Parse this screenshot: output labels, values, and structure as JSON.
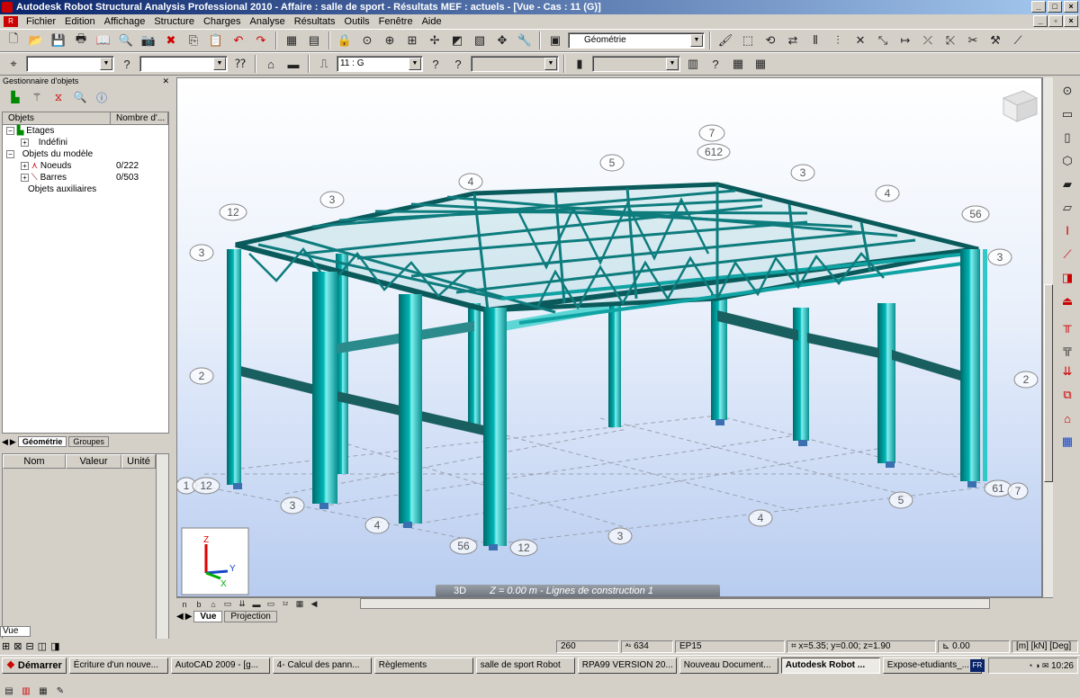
{
  "title": "Autodesk Robot Structural Analysis Professional 2010 - Affaire : salle de sport - Résultats MEF : actuels - [Vue - Cas : 11 (G)]",
  "menu": [
    "Fichier",
    "Edition",
    "Affichage",
    "Structure",
    "Charges",
    "Analyse",
    "Résultats",
    "Outils",
    "Fenêtre",
    "Aide"
  ],
  "toolbar": {
    "layout_combo": "Géométrie",
    "case_combo": "11 : G"
  },
  "object_manager": {
    "title": "Gestionnaire d'objets",
    "col_objects": "Objets",
    "col_count": "Nombre d'...",
    "tree": {
      "etages": "Etages",
      "indefini": "Indéfini",
      "objets_modele": "Objets du modèle",
      "noeuds": "Noeuds",
      "noeuds_count": "0/222",
      "barres": "Barres",
      "barres_count": "0/503",
      "objets_aux": "Objets auxiliaires"
    },
    "tabs": [
      "Géométrie",
      "Groupes"
    ]
  },
  "properties": {
    "col_name": "Nom",
    "col_value": "Valeur",
    "col_unit": "Unité"
  },
  "view": {
    "overlay_mode": "3D",
    "overlay_text": "Z = 0.00 m - Lignes de construction 1",
    "tabs": [
      "Vue",
      "Projection"
    ],
    "axis_labels": {
      "z": "Z",
      "x": "X",
      "y": "Y"
    },
    "grid_labels": {
      "top_7": "7",
      "top_612": "612",
      "top_5": "5",
      "top_3a": "3",
      "top_4a": "4",
      "top_3b": "3",
      "top_4b": "4",
      "top_56": "56",
      "left_12": "12",
      "left_3": "3",
      "right_3": "3",
      "left_2": "2",
      "right_2": "2",
      "bl_1": "1",
      "bl_12": "12",
      "b_3a": "3",
      "b_4": "4",
      "b_56": "56",
      "b_12": "12",
      "b_3b": "3",
      "b_4b": "4",
      "b_5": "5",
      "br_61": "61",
      "br_7": "7"
    }
  },
  "command_box": "Vue",
  "statusbar": {
    "nodes": "260",
    "bars": "634",
    "code": "EP15",
    "coords": "x=5.35; y=0.00; z=1.90",
    "value": "0.00",
    "units": "[m] [kN] [Deg]"
  },
  "taskbar": {
    "start": "Démarrer",
    "tasks": [
      "Écriture d'un nouve...",
      "AutoCAD 2009 - [g...",
      "4- Calcul des pann...",
      "Règlements",
      "salle de sport Robot",
      "RPA99 VERSION 20...",
      "Nouveau Document...",
      "Autodesk Robot ...",
      "Expose-etudiants_..."
    ],
    "active_task": 7,
    "lang": "FR",
    "time": "10:26"
  }
}
